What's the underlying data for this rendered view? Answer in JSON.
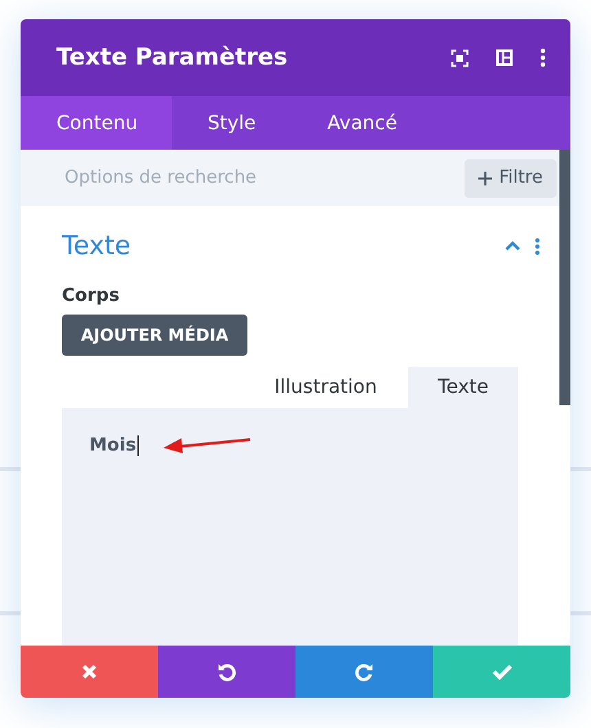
{
  "window": {
    "title": "Texte Paramètres"
  },
  "tabs": [
    {
      "label": "Contenu",
      "selected": true
    },
    {
      "label": "Style",
      "selected": false
    },
    {
      "label": "Avancé",
      "selected": false
    }
  ],
  "search": {
    "placeholder": "Options de recherche",
    "filter_button": "Filtre"
  },
  "section": {
    "title": "Texte",
    "expanded": true,
    "field_label": "Corps",
    "media_button": "AJOUTER MÉDIA",
    "editor_tabs": [
      {
        "label": "Illustration",
        "selected": false
      },
      {
        "label": "Texte",
        "selected": true
      }
    ],
    "editor_value": "Mois"
  },
  "footer": [
    {
      "kind": "cancel",
      "color": "#ef5555"
    },
    {
      "kind": "undo",
      "color": "#7e3bd0"
    },
    {
      "kind": "redo",
      "color": "#2b87da"
    },
    {
      "kind": "save",
      "color": "#29c4a9"
    }
  ]
}
